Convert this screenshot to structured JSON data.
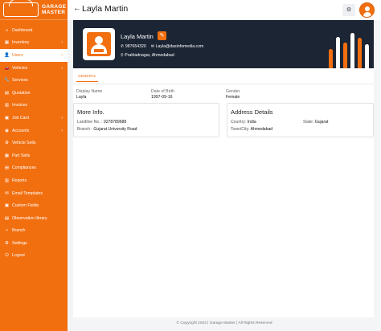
{
  "app": {
    "logo_line1": "GARAGE",
    "logo_line2": "MASTER"
  },
  "sidebar": {
    "items": [
      {
        "label": "Dashboard",
        "icon": "home-icon",
        "glyph": "⌂",
        "caret": false
      },
      {
        "label": "Inventory",
        "icon": "grid-icon",
        "glyph": "▦",
        "caret": true
      },
      {
        "label": "Users",
        "icon": "user-icon",
        "glyph": "👤",
        "caret": true,
        "active": true
      },
      {
        "label": "Vehicles",
        "icon": "car-icon",
        "glyph": "🚗",
        "caret": true
      },
      {
        "label": "Services",
        "icon": "wrench-icon",
        "glyph": "🔧",
        "caret": false
      },
      {
        "label": "Quotation",
        "icon": "document-icon",
        "glyph": "▤",
        "caret": false
      },
      {
        "label": "Invoices",
        "icon": "invoice-icon",
        "glyph": "▥",
        "caret": false
      },
      {
        "label": "Job Card",
        "icon": "jobcard-icon",
        "glyph": "▣",
        "caret": true
      },
      {
        "label": "Accounts",
        "icon": "accounts-icon",
        "glyph": "◉",
        "caret": true
      },
      {
        "label": "Vehicle Sells",
        "icon": "vehicle-sell-icon",
        "glyph": "⚙",
        "caret": false
      },
      {
        "label": "Part Sells",
        "icon": "part-sell-icon",
        "glyph": "▦",
        "caret": false
      },
      {
        "label": "Compliances",
        "icon": "compliance-icon",
        "glyph": "▤",
        "caret": false
      },
      {
        "label": "Reports",
        "icon": "reports-icon",
        "glyph": "▥",
        "caret": false
      },
      {
        "label": "Email Templates",
        "icon": "email-icon",
        "glyph": "✉",
        "caret": false
      },
      {
        "label": "Custom Fields",
        "icon": "custom-fields-icon",
        "glyph": "▣",
        "caret": false
      },
      {
        "label": "Observation library",
        "icon": "library-icon",
        "glyph": "▤",
        "caret": false
      },
      {
        "label": "Branch",
        "icon": "branch-icon",
        "glyph": "⑂",
        "caret": false
      },
      {
        "label": "Settings",
        "icon": "gear-icon",
        "glyph": "⚙",
        "caret": false
      },
      {
        "label": "Logout",
        "icon": "logout-icon",
        "glyph": "⏻",
        "caret": false
      }
    ]
  },
  "header": {
    "title": "Layla Martin",
    "settings_glyph": "⚙"
  },
  "profile": {
    "name": "Layla Martin",
    "phone": "987654320",
    "email": "Layla@dasinfomedia.com",
    "address": "Prahladnagar, Ahmedabad"
  },
  "tabs": {
    "general": "GENERAL"
  },
  "general": {
    "display_name_label": "Display Name",
    "display_name": "Layla",
    "dob_label": "Date of Birth",
    "dob": "1997-09-16",
    "gender_label": "Gender",
    "gender": "Female"
  },
  "more_info": {
    "title": "More Info.",
    "landline_label": "Landline No. :",
    "landline": "0278789688",
    "branch_label": "Branch :",
    "branch": "Gujarat University Road"
  },
  "address_details": {
    "title": "Address Details",
    "country_label": "Country:",
    "country": "India",
    "state_label": "State:",
    "state": "Gujarat",
    "city_label": "Town/City:",
    "city": "Ahmedabad"
  },
  "footer": {
    "text": "© Copyright 2023 | Garage Master | All Rights Reserved"
  },
  "colors": {
    "accent": "#f26f10",
    "header_dark": "#1c2534"
  }
}
